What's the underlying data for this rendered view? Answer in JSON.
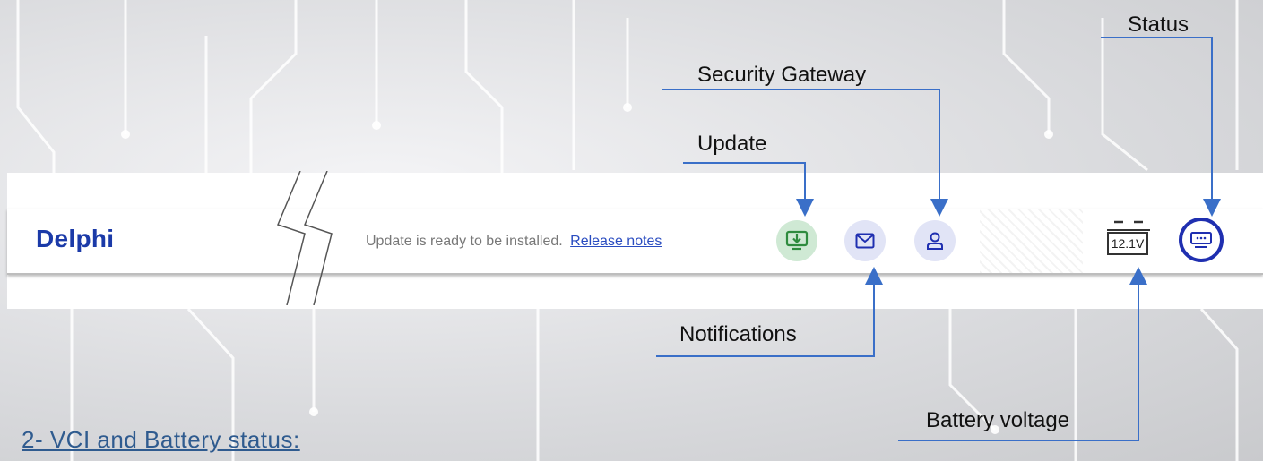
{
  "app": {
    "logo_text": "Delphi",
    "update_message": "Update is ready to be installed.",
    "release_notes_link": "Release notes",
    "battery_voltage": "12.1V"
  },
  "icons": {
    "update": "download-monitor-icon",
    "notifications": "mail-icon",
    "security_gateway": "user-icon",
    "battery": "battery-icon",
    "status": "vci-status-icon"
  },
  "colors": {
    "brand": "#1b3aa8",
    "update_bg": "#cfe9d4",
    "update_icon": "#2e8b3e",
    "pill_bg": "#e1e4f6",
    "pill_icon": "#1f2fb0",
    "callout_line": "#3a6fc8",
    "heading": "#2f5b8f"
  },
  "annotations": {
    "status": "Status",
    "security_gateway": "Security Gateway",
    "update": "Update",
    "notifications": "Notifications",
    "battery_voltage": "Battery voltage"
  },
  "section_heading": "2- VCI and Battery status:"
}
